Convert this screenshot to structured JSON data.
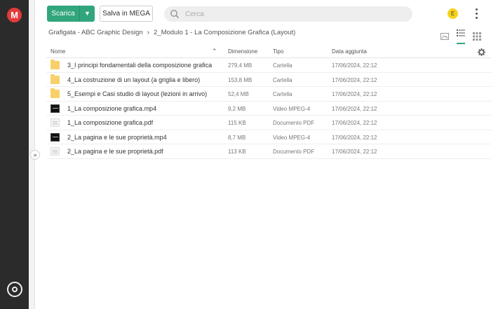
{
  "topbar": {
    "download_label": "Scarica",
    "save_label": "Salva in MEGA",
    "search_placeholder": "Cerca",
    "avatar_initial": "E"
  },
  "brand": {
    "logo_letter": "M",
    "color": "#e23b3b"
  },
  "breadcrumb": {
    "root": "Grafigata - ABC Graphic Design",
    "current": "2_Modulo 1 - La Composizione Grafica (Layout)"
  },
  "table": {
    "headers": {
      "name": "Nome",
      "size": "Dimensione",
      "type": "Tipo",
      "date": "Data aggiunta"
    },
    "rows": [
      {
        "icon": "folder-icon",
        "name": "3_I principi fondamentali della composizione grafica",
        "size": "279,4 MB",
        "type": "Cartella",
        "date": "17/06/2024, 22:12"
      },
      {
        "icon": "folder-icon",
        "name": "4_La costruzione di un layout (a griglia e libero)",
        "size": "153,8 MB",
        "type": "Cartella",
        "date": "17/06/2024, 22:12"
      },
      {
        "icon": "folder-icon",
        "name": "5_Esempi e Casi studio di layout (lezioni in arrivo)",
        "size": "52,4 MB",
        "type": "Cartella",
        "date": "17/06/2024, 22:12"
      },
      {
        "icon": "video-icon",
        "name": "1_La composizione grafica.mp4",
        "size": "9,2 MB",
        "type": "Video MPEG-4",
        "date": "17/06/2024, 22:12"
      },
      {
        "icon": "pdf-icon",
        "name": "1_La composizione grafica.pdf",
        "size": "115 KB",
        "type": "Documento PDF",
        "date": "17/06/2024, 22:12"
      },
      {
        "icon": "video-icon",
        "name": "2_La pagina e le sue proprietà.mp4",
        "size": "8,7 MB",
        "type": "Video MPEG-4",
        "date": "17/06/2024, 22:12"
      },
      {
        "icon": "pdf-icon",
        "name": "2_La pagina e le sue proprietà.pdf",
        "size": "113 KB",
        "type": "Documento PDF",
        "date": "17/06/2024, 22:12"
      }
    ]
  },
  "colors": {
    "accent": "#31a67d",
    "rail": "#2b2b2b",
    "avatar": "#f7d31b"
  }
}
